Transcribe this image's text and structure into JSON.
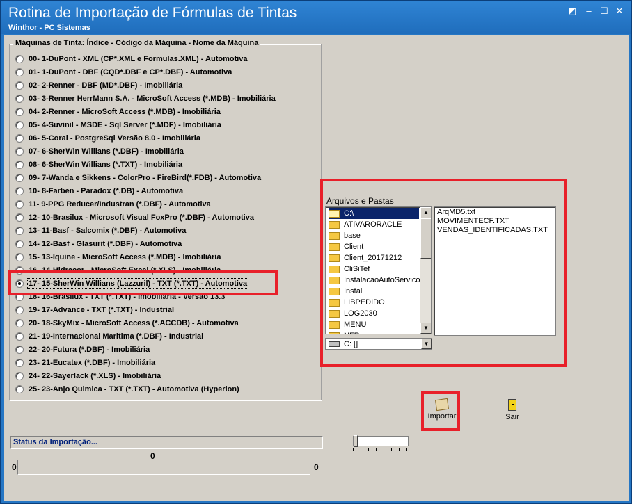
{
  "window": {
    "title": "Rotina de Importação de Fórmulas de Tintas",
    "subtitle": "Winthor - PC Sistemas"
  },
  "machines": {
    "legend": "Máquinas de Tinta: Índice - Código da Máquina - Nome da Máquina",
    "selected_index": 17,
    "items": [
      "00-  1-DuPont - XML (CP*.XML  e  Formulas.XML) - Automotiva",
      "01-  1-DuPont - DBF (CQD*.DBF  e  CP*.DBF) - Automotiva",
      "02-  2-Renner - DBF (MD*.DBF) - Imobiliária",
      "03-  3-Renner HerrMann S.A. - MicroSoft Access (*.MDB) - Imobiliária",
      "04-  2-Renner - MicroSoft Access (*.MDB) - Imobiliária",
      "05-  4-Suvinil - MSDE - Sql Server (*.MDF) - Imobiliária",
      "06-  5-Coral - PostgreSql Versão 8.0 - Imobiliária",
      "07-  6-SherWin Willians (*.DBF) - Imobiliária",
      "08-  6-SherWin Willians (*.TXT) - Imobiliária",
      "09-  7-Wanda e Sikkens - ColorPro - FireBird(*.FDB) - Automotiva",
      "10-  8-Farben - Paradox (*.DB) - Automotiva",
      "11-  9-PPG Reducer/Industran (*.DBF) - Automotiva",
      "12- 10-Brasilux - Microsoft Visual FoxPro (*.DBF) - Automotiva",
      "13- 11-Basf - Salcomix (*.DBF) - Automotiva",
      "14- 12-Basf - Glasurit (*.DBF) - Automotiva",
      "15- 13-Iquine - MicroSoft Access (*.MDB) - Imobiliária",
      "16- 14-Hidracor - MicroSoft Excel (*.XLS) - Imobiliária",
      "17- 15-SherWin Willians (Lazzuril) - TXT (*.TXT) - Automotiva",
      "18- 16-Brasilux - TXT (*.TXT) - Imobiliaria - Versão 13.3",
      "19- 17-Advance - TXT (*.TXT) - Industrial",
      "20- 18-SkyMix - MicroSoft Access (*.ACCDB) - Automotiva",
      "21- 19-Internacional Maritima (*.DBF) - Industrial",
      "22- 20-Futura (*.DBF) - Imobiliária",
      "23- 21-Eucatex (*.DBF) - Imobiliária",
      "24- 22-Sayerlack (*.XLS) - Imobiliária",
      "25- 23-Anjo Quimica - TXT (*.TXT) - Automotiva (Hyperion)"
    ]
  },
  "files": {
    "label": "Arquivos e Pastas",
    "folders": [
      "C:\\",
      "ATIVARORACLE",
      "base",
      "Client",
      "Client_20171212",
      "CliSiTef",
      "InstalacaoAutoServico",
      "Install",
      "LIBPEDIDO",
      "LOG2030",
      "MENU",
      "NFR"
    ],
    "selected_folder": "C:\\",
    "drive": "C: []",
    "file_list": [
      "ArqMD5.txt",
      "MOVIMENTECF.TXT",
      "VENDAS_IDENTIFICADAS.TXT"
    ]
  },
  "buttons": {
    "import": "Importar",
    "exit": "Sair"
  },
  "status": {
    "text": "Status da Importação...",
    "progress_value": "0",
    "progress_min": "0",
    "progress_max": "0"
  },
  "colors": {
    "title_bar": "#2576c4",
    "highlight": "#e8202a",
    "status_text": "#00207a"
  }
}
